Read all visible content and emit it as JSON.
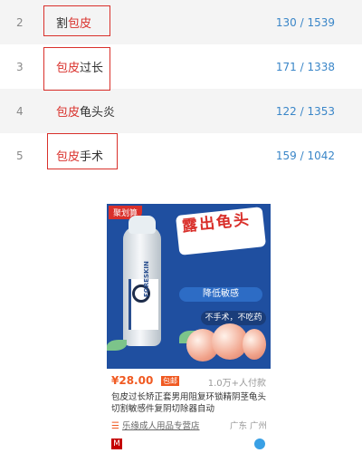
{
  "ranking": [
    {
      "rank": "2",
      "prefix": "割",
      "highlight": "包皮",
      "suffix": "",
      "count": "130 / 1539",
      "boxed": true
    },
    {
      "rank": "3",
      "prefix": "",
      "highlight": "包皮",
      "suffix": "过长",
      "count": "171 / 1338",
      "boxed": true
    },
    {
      "rank": "4",
      "prefix": "",
      "highlight": "包皮",
      "suffix": "龟头炎",
      "count": "122 / 1353",
      "boxed": false
    },
    {
      "rank": "5",
      "prefix": "",
      "highlight": "包皮",
      "suffix": "手术",
      "count": "159 / 1042",
      "boxed": true
    }
  ],
  "product": {
    "image_badge": "聚划算",
    "image_headline": "露出龟头",
    "image_pill_1": "降低敏感",
    "image_pill_2": "不手术，不吃药",
    "image_brand": "FORESKIN",
    "price": "¥28.00",
    "price_tag": "包邮",
    "sales": "1.0万+人付款",
    "title": "包皮过长矫正套男用阻复环锁精阴茎龟头切割敏感件复阴切除器自动",
    "shop": "乐缘成人用品专营店",
    "location": "广东 广州",
    "tmall_icon_text": "M"
  }
}
